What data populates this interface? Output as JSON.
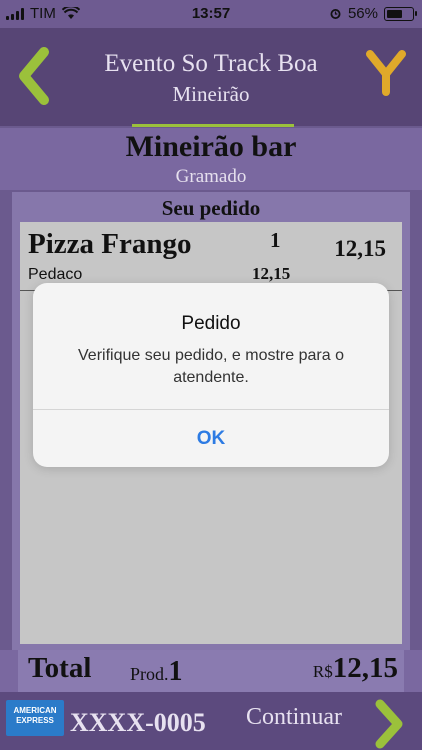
{
  "status_bar": {
    "carrier": "TIM",
    "time": "13:57",
    "battery": "56%",
    "battery_level": 0.56
  },
  "header": {
    "title": "Evento So Track Boa",
    "subtitle": "Mineirão",
    "back_icon": "chevron-left-icon",
    "action_icon": "y-logo-icon"
  },
  "venue": {
    "name": "Mineirão bar",
    "area": "Gramado"
  },
  "order": {
    "heading": "Seu pedido",
    "items": [
      {
        "name": "Pizza Frango",
        "qty": "1",
        "price": "12,15",
        "desc": "Pedaco",
        "subtotal": "12,15"
      }
    ]
  },
  "total": {
    "label": "Total",
    "prod_label": "Prod.",
    "prod_count": "1",
    "currency": "R$",
    "amount": "12,15"
  },
  "footer": {
    "card_brand_line1": "AMERICAN",
    "card_brand_line2": "EXPRESS",
    "card_number": "XXXX-0005",
    "continue_label": "Continuar",
    "next_icon": "chevron-right-icon"
  },
  "alert": {
    "title": "Pedido",
    "message": "Verifique seu pedido, e mostre para o atendente.",
    "ok_label": "OK"
  },
  "colors": {
    "accent_green": "#9bc13b",
    "accent_yellow": "#e0a92a",
    "link_blue": "#2d7be3"
  }
}
